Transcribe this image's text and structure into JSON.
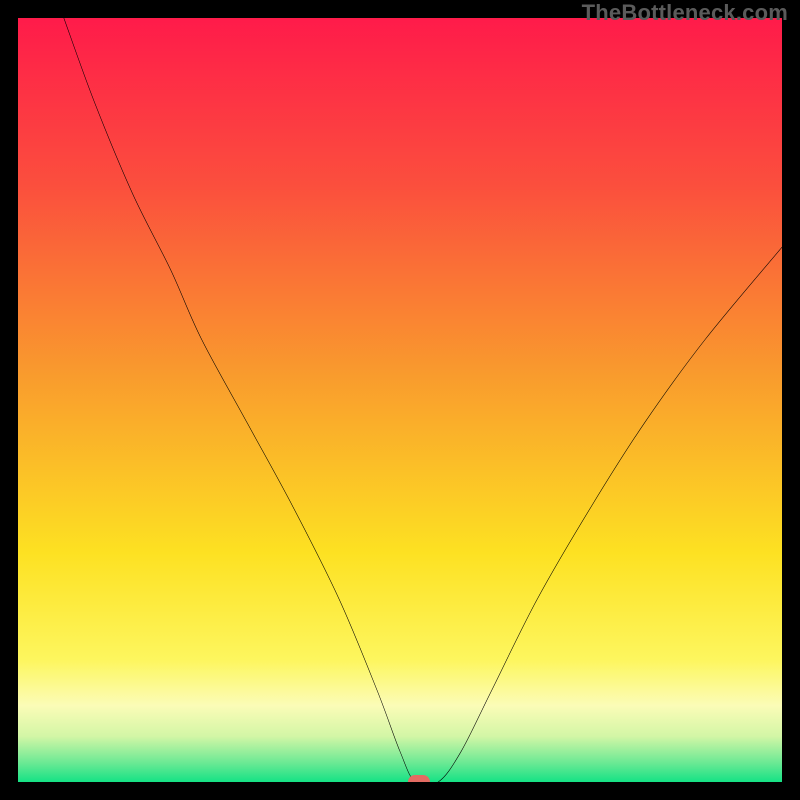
{
  "watermark": "TheBottleneck.com",
  "chart_data": {
    "type": "line",
    "title": "",
    "xlabel": "",
    "ylabel": "",
    "xlim": [
      0,
      100
    ],
    "ylim": [
      0,
      100
    ],
    "grid": false,
    "annotations": [
      {
        "label": "optimal-marker",
        "x": 52.5,
        "y": 0
      }
    ],
    "background_gradient_stops": [
      {
        "pos": 0.0,
        "color": "#ff1b4a"
      },
      {
        "pos": 0.22,
        "color": "#fb4f3d"
      },
      {
        "pos": 0.47,
        "color": "#f99c2d"
      },
      {
        "pos": 0.7,
        "color": "#fde122"
      },
      {
        "pos": 0.84,
        "color": "#fdf65e"
      },
      {
        "pos": 0.9,
        "color": "#fbfcb7"
      },
      {
        "pos": 0.94,
        "color": "#d3f6a6"
      },
      {
        "pos": 0.975,
        "color": "#6be994"
      },
      {
        "pos": 1.0,
        "color": "#15e285"
      }
    ],
    "series": [
      {
        "name": "bottleneck-curve",
        "x": [
          6,
          10,
          15,
          20,
          24,
          30,
          36,
          42,
          47,
          50,
          52,
          55,
          58,
          62,
          68,
          75,
          82,
          90,
          100
        ],
        "y": [
          100,
          89,
          77,
          67,
          58,
          47,
          36,
          24,
          12,
          4,
          0,
          0,
          4,
          12,
          24,
          36,
          47,
          58,
          70
        ]
      }
    ]
  }
}
